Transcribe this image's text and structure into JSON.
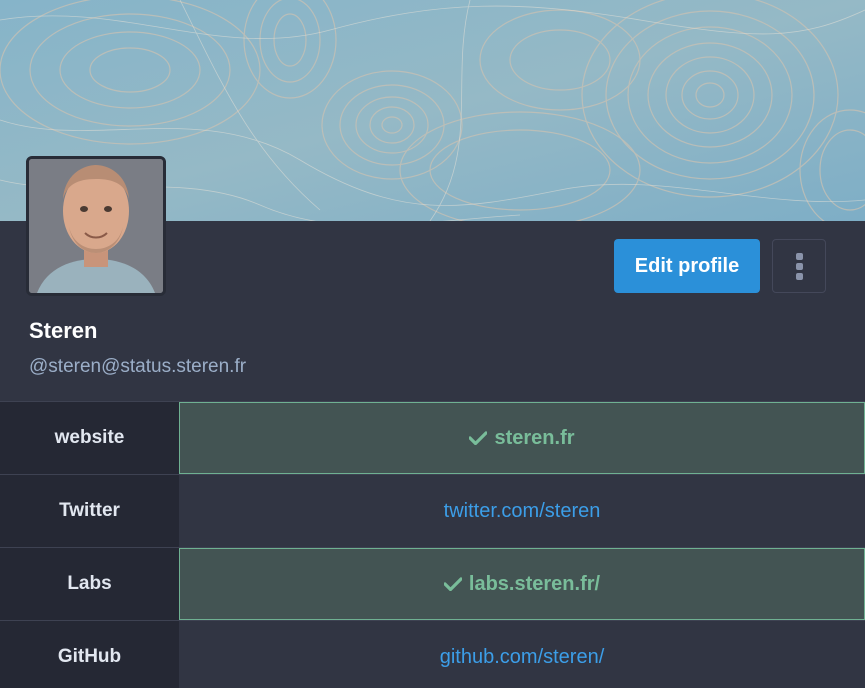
{
  "profile": {
    "display_name": "Steren",
    "handle": "@steren@status.steren.fr",
    "header_image": "swirl-pattern-header",
    "avatar": "profile-photo"
  },
  "actions": {
    "edit_profile_label": "Edit profile",
    "more_icon": "vertical-ellipsis-icon"
  },
  "fields": [
    {
      "label": "website",
      "value": "steren.fr",
      "verified": true
    },
    {
      "label": "Twitter",
      "value": "twitter.com/steren",
      "verified": false
    },
    {
      "label": "Labs",
      "value": "labs.steren.fr/",
      "verified": true
    },
    {
      "label": "GitHub",
      "value": "github.com/steren/",
      "verified": false
    }
  ],
  "colors": {
    "background": "#313543",
    "accent": "#2b90d9",
    "verified": "#79bd9a",
    "link": "#3c9ee8"
  }
}
